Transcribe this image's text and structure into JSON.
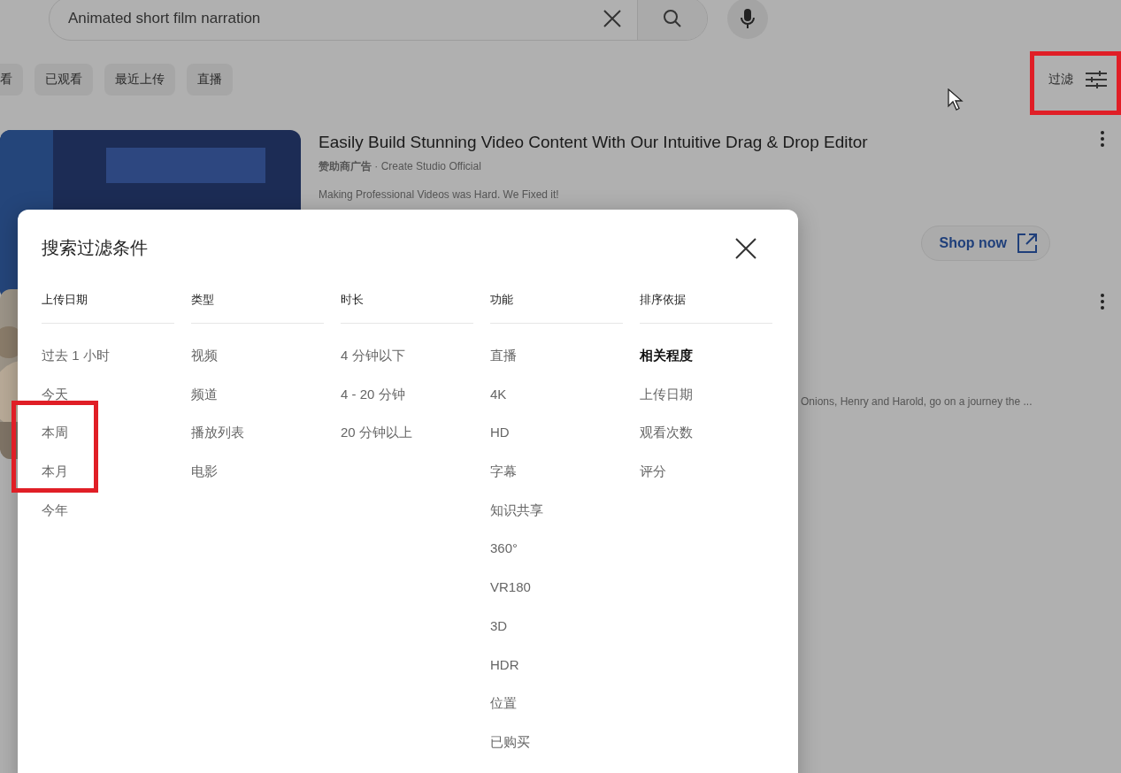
{
  "search": {
    "value": "Animated short film narration"
  },
  "chips": [
    {
      "label": "看"
    },
    {
      "label": "已观看"
    },
    {
      "label": "最近上传"
    },
    {
      "label": "直播"
    }
  ],
  "filter_button": {
    "label": "过滤"
  },
  "results": [
    {
      "title": "Easily Build Stunning Video Content With Our Intuitive Drag & Drop Editor",
      "byline": "**赞助商广告** · Create Studio Official",
      "description": "Making Professional Videos was Hard. We Fixed it!",
      "action": "Shop now"
    },
    {
      "description": "Onions, Henry and Harold, go on a journey the ..."
    }
  ],
  "dialog": {
    "title": "搜索过滤条件",
    "columns": [
      {
        "heading": "上传日期",
        "options": [
          {
            "label": "过去 1 小时",
            "selected": false
          },
          {
            "label": "今天",
            "selected": false
          },
          {
            "label": "本周",
            "selected": false
          },
          {
            "label": "本月",
            "selected": false
          },
          {
            "label": "今年",
            "selected": false
          }
        ]
      },
      {
        "heading": "类型",
        "options": [
          {
            "label": "视频",
            "selected": false
          },
          {
            "label": "频道",
            "selected": false
          },
          {
            "label": "播放列表",
            "selected": false
          },
          {
            "label": "电影",
            "selected": false
          }
        ]
      },
      {
        "heading": "时长",
        "options": [
          {
            "label": "4 分钟以下",
            "selected": false
          },
          {
            "label": "4 - 20 分钟",
            "selected": false
          },
          {
            "label": "20 分钟以上",
            "selected": false
          }
        ]
      },
      {
        "heading": "功能",
        "options": [
          {
            "label": "直播",
            "selected": false
          },
          {
            "label": "4K",
            "selected": false
          },
          {
            "label": "HD",
            "selected": false
          },
          {
            "label": "字幕",
            "selected": false
          },
          {
            "label": "知识共享",
            "selected": false
          },
          {
            "label": "360°",
            "selected": false
          },
          {
            "label": "VR180",
            "selected": false
          },
          {
            "label": "3D",
            "selected": false
          },
          {
            "label": "HDR",
            "selected": false
          },
          {
            "label": "位置",
            "selected": false
          },
          {
            "label": "已购买",
            "selected": false
          }
        ]
      },
      {
        "heading": "排序依据",
        "options": [
          {
            "label": "相关程度",
            "selected": true
          },
          {
            "label": "上传日期",
            "selected": false
          },
          {
            "label": "观看次数",
            "selected": false
          },
          {
            "label": "评分",
            "selected": false
          }
        ]
      }
    ]
  }
}
